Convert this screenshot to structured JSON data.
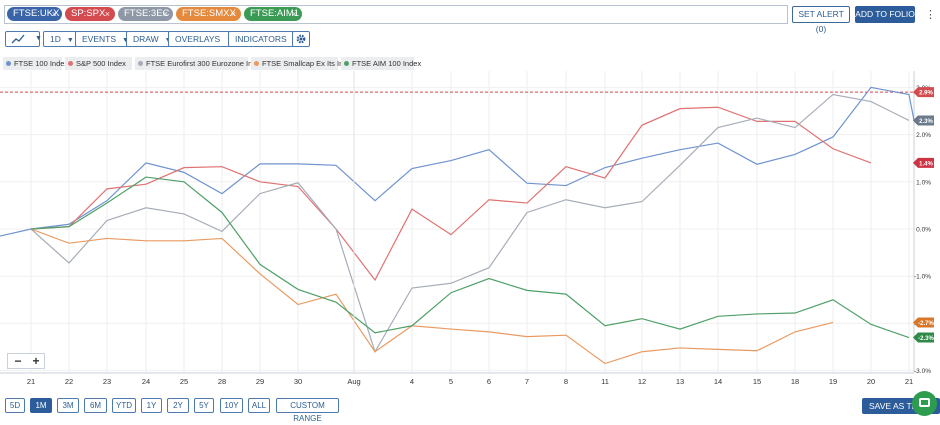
{
  "symbols": [
    {
      "label": "FTSE:UKX",
      "color": "#3a64a8"
    },
    {
      "label": "SP:SPX",
      "color": "#d34a4f"
    },
    {
      "label": "FTSE:3EC",
      "color": "#8f98a6"
    },
    {
      "label": "FTSE:SMXX",
      "color": "#e58a3c"
    },
    {
      "label": "FTSE:AIM1",
      "color": "#3b9a54"
    }
  ],
  "header": {
    "set_alert_label": "SET ALERT",
    "set_alert_count": "(0)",
    "add_to_folio_label": "ADD TO FOLIO"
  },
  "toolbar": {
    "chart_type_icon": "line-chart-icon",
    "interval": "1D",
    "events": "EVENTS",
    "draw": "DRAW",
    "overlays": "OVERLAYS",
    "indicators": "INDICATORS",
    "settings_icon": "gear-icon"
  },
  "zoom": {
    "minus": "−",
    "plus": "+"
  },
  "ranges": [
    "5D",
    "1M",
    "3M",
    "6M",
    "YTD",
    "1Y",
    "2Y",
    "5Y",
    "10Y",
    "ALL",
    "CUSTOM RANGE"
  ],
  "active_range": "1M",
  "save_label": "SAVE AS TEMP",
  "chart_data": {
    "type": "line",
    "x": [
      "21",
      "22",
      "23",
      "24",
      "25",
      "28",
      "29",
      "30",
      "Aug",
      "4",
      "5",
      "6",
      "7",
      "8",
      "11",
      "12",
      "13",
      "14",
      "15",
      "18",
      "19",
      "20",
      "21"
    ],
    "ylim": [
      -3.0,
      3.0
    ],
    "yticks": [
      "3.0%",
      "2.0%",
      "1.0%",
      "0.0%",
      "-1.0%",
      "-2.0%",
      "-3.0%"
    ],
    "grid": true,
    "legend_position": "top-left",
    "reference_line": {
      "value": 2.9,
      "color": "#d34a4f"
    },
    "series": [
      {
        "name": "FTSE 100 Index",
        "color": "#6f93cf",
        "label": "2.3%",
        "label_color": "#6c7a8c",
        "values": [
          -0.15,
          0.0,
          0.1,
          0.6,
          1.4,
          1.2,
          0.75,
          1.38,
          1.38,
          1.35,
          0.6,
          1.28,
          1.45,
          1.68,
          0.97,
          0.92,
          1.3,
          1.5,
          1.68,
          1.82,
          1.37,
          1.58,
          1.95,
          3.0,
          2.85,
          2.3
        ]
      },
      {
        "name": "S&P 500 Index",
        "color": "#e07272",
        "label": "1.4%",
        "label_color": "#cc3344",
        "values": [
          null,
          0.0,
          0.05,
          0.85,
          0.95,
          1.3,
          1.32,
          1.0,
          0.9,
          0.0,
          -1.08,
          0.42,
          -0.12,
          0.62,
          0.55,
          1.32,
          1.08,
          2.2,
          2.55,
          2.58,
          2.28,
          2.28,
          1.7,
          1.4,
          null
        ]
      },
      {
        "name": "FTSE Eurofirst 300 Eurozone Index",
        "color": "#a7adb8",
        "label": "2.3%",
        "label_color": "#6c7a8c",
        "values": [
          null,
          0.0,
          -0.72,
          0.18,
          0.45,
          0.32,
          -0.05,
          0.75,
          0.98,
          0.0,
          -2.6,
          -1.25,
          -1.15,
          -0.82,
          0.35,
          0.62,
          0.45,
          0.58,
          1.35,
          2.15,
          2.35,
          2.15,
          2.85,
          2.7,
          2.3
        ]
      },
      {
        "name": "FTSE Smallcap Ex Its Index",
        "color": "#e89a62",
        "label": "-2.7%",
        "label_color": "#d8772a",
        "values": [
          null,
          0.0,
          -0.3,
          -0.2,
          -0.25,
          -0.25,
          -0.2,
          -0.95,
          -1.6,
          -1.38,
          -2.6,
          -2.05,
          -2.12,
          -2.18,
          -2.28,
          -2.25,
          -2.85,
          -2.6,
          -2.52,
          -2.55,
          -2.58,
          -2.18,
          -1.98,
          null,
          null
        ]
      },
      {
        "name": "FTSE AIM 100 Index",
        "color": "#4fa068",
        "label": "-2.3%",
        "label_color": "#2f8a4a",
        "values": [
          null,
          0.0,
          0.05,
          0.55,
          1.1,
          1.0,
          0.35,
          -0.75,
          -1.28,
          -1.55,
          -2.2,
          -2.05,
          -1.35,
          -1.05,
          -1.3,
          -1.38,
          -2.05,
          -1.9,
          -2.12,
          -1.85,
          -1.8,
          -1.78,
          -1.5,
          -2.02,
          -2.3
        ]
      }
    ]
  }
}
